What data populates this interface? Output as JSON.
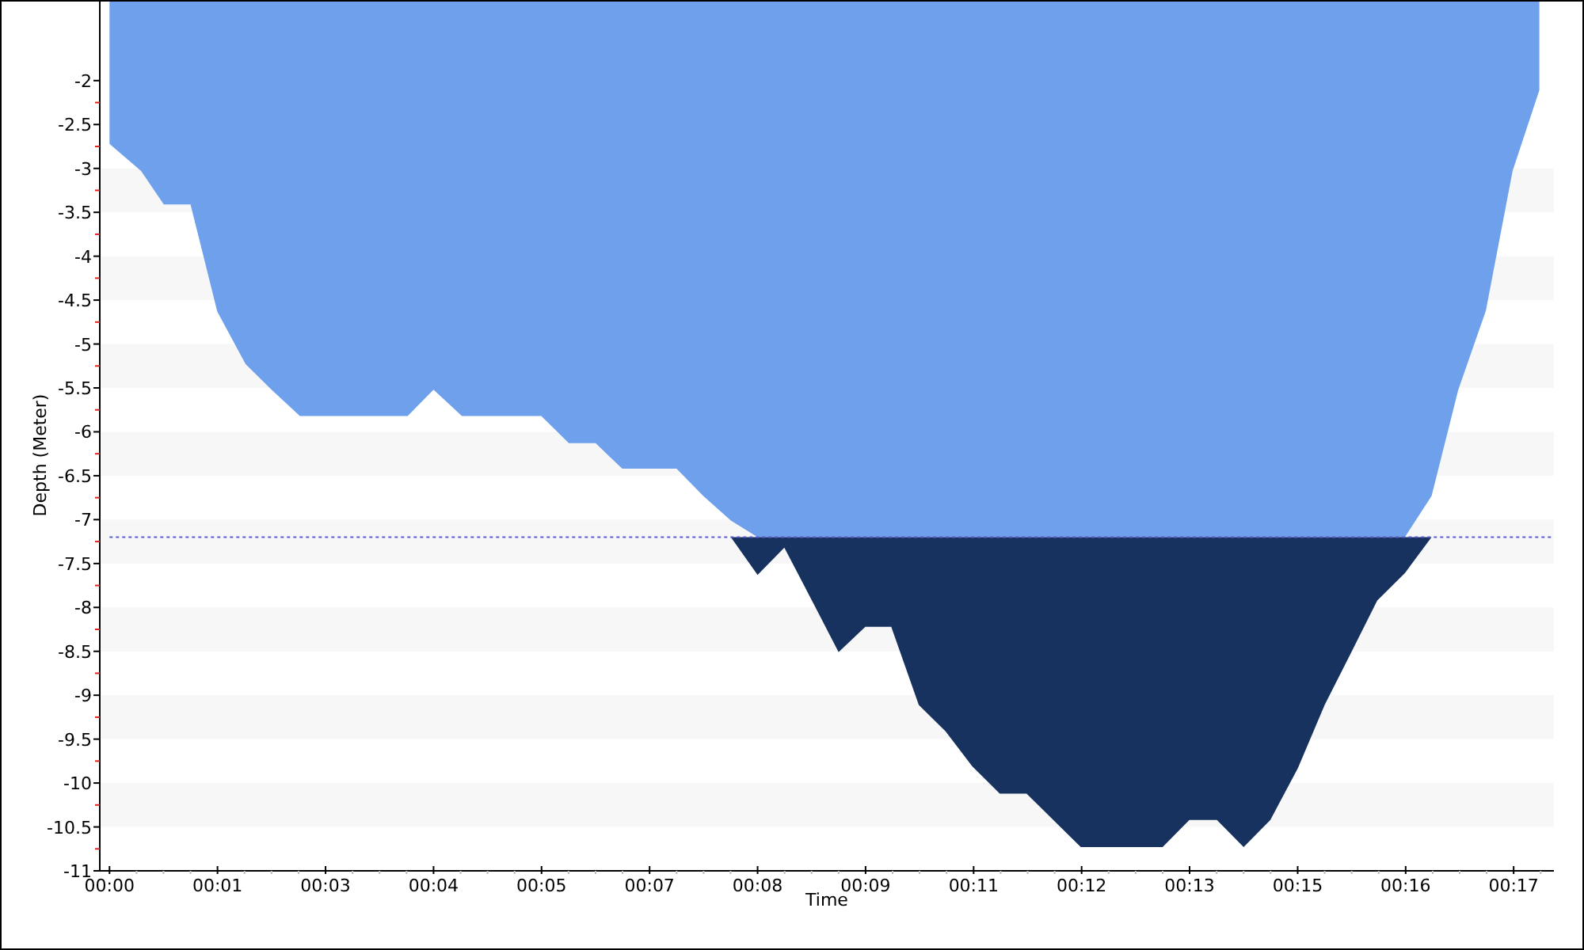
{
  "chart_data": {
    "type": "area",
    "xlabel": "Time",
    "ylabel": "Depth (Meter)",
    "x": [
      0,
      0.39,
      0.67,
      1.0,
      1.33,
      1.68,
      2.0,
      2.35,
      3.68,
      4.0,
      4.35,
      5.33,
      5.67,
      6.0,
      6.33,
      7.0,
      7.33,
      7.67,
      8.0,
      8.33,
      8.67,
      9.0,
      9.33,
      9.65,
      9.99,
      10.32,
      10.65,
      10.99,
      11.32,
      11.65,
      11.99,
      13.0,
      13.33,
      13.67,
      14.0,
      14.33,
      14.67,
      15.0,
      15.33,
      15.65,
      15.99,
      16.32,
      16.65,
      16.99,
      17.32,
      17.65
    ],
    "series": [
      {
        "color": "#6fa0ec",
        "values": [
          -2.72,
          -3.03,
          -3.41,
          -3.41,
          -4.63,
          -5.23,
          -5.52,
          -5.82,
          -5.82,
          -5.52,
          -5.82,
          -5.82,
          -6.13,
          -6.13,
          -6.42,
          -6.42,
          -6.73,
          -7.01,
          -7.2,
          -7.2,
          -7.2,
          -7.2,
          -7.2,
          -7.2,
          -7.2,
          -7.2,
          -7.2,
          -7.2,
          -7.2,
          -7.2,
          -7.2,
          -7.2,
          -7.2,
          -7.2,
          -7.2,
          -7.2,
          -7.2,
          -7.2,
          -7.2,
          -7.2,
          -7.2,
          -6.73,
          -5.52,
          -4.62,
          -3.03,
          -2.11
        ]
      },
      {
        "color": "#17325f",
        "values": [
          null,
          null,
          null,
          null,
          null,
          null,
          null,
          null,
          null,
          null,
          null,
          null,
          null,
          null,
          null,
          null,
          null,
          -7.2,
          -7.63,
          -7.32,
          -7.92,
          -8.51,
          -8.22,
          -8.22,
          -9.11,
          -9.41,
          -9.81,
          -10.12,
          -10.12,
          -10.42,
          -10.73,
          -10.73,
          -10.42,
          -10.42,
          -10.73,
          -10.42,
          -9.83,
          -9.11,
          -8.51,
          -7.92,
          -7.61,
          -7.2,
          null,
          null,
          null,
          null
        ]
      }
    ],
    "xlim": [
      -0.12,
      17.83
    ],
    "ylim": [
      -11,
      -1.1
    ],
    "xticks": [
      {
        "value": 0,
        "label": "00:00"
      },
      {
        "value": 1.333,
        "label": "00:01"
      },
      {
        "value": 2.667,
        "label": "00:03"
      },
      {
        "value": 4,
        "label": "00:04"
      },
      {
        "value": 5.333,
        "label": "00:05"
      },
      {
        "value": 6.667,
        "label": "00:07"
      },
      {
        "value": 8,
        "label": "00:08"
      },
      {
        "value": 9.333,
        "label": "00:09"
      },
      {
        "value": 10.667,
        "label": "00:11"
      },
      {
        "value": 12,
        "label": "00:12"
      },
      {
        "value": 13.333,
        "label": "00:13"
      },
      {
        "value": 14.667,
        "label": "00:15"
      },
      {
        "value": 16,
        "label": "00:16"
      },
      {
        "value": 17.333,
        "label": "00:17"
      }
    ],
    "yticks": [
      -2,
      -2.5,
      -3,
      -3.5,
      -4,
      -4.5,
      -5,
      -5.5,
      -6,
      -6.5,
      -7,
      -7.5,
      -8,
      -8.5,
      -9,
      -9.5,
      -10,
      -10.5,
      -11
    ],
    "ref_lines": [
      {
        "axis": "y",
        "value": -7.2,
        "color": "#5a5ad0"
      }
    ]
  }
}
